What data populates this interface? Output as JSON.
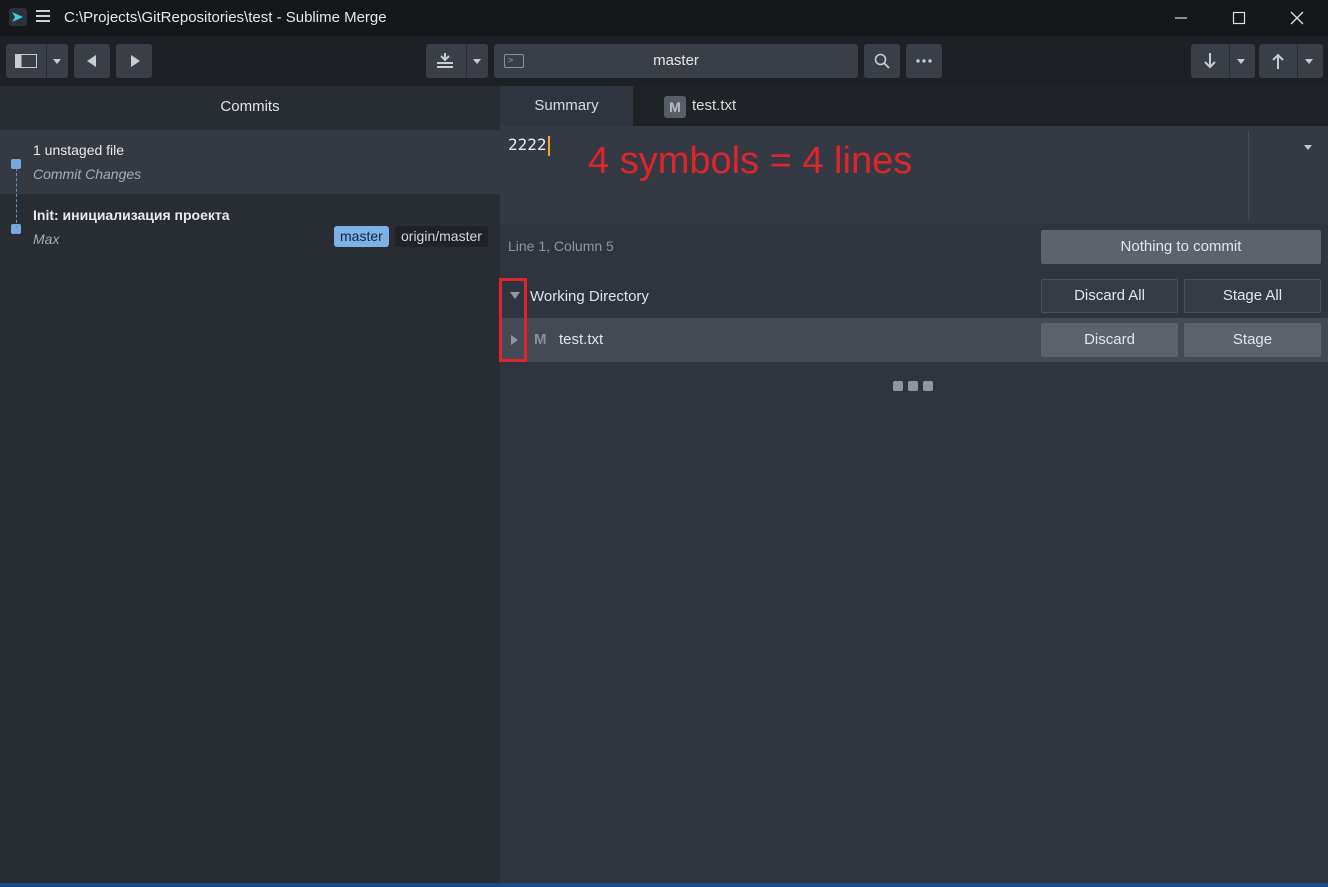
{
  "window": {
    "title": "C:\\Projects\\GitRepositories\\test - Sublime Merge"
  },
  "toolbar": {
    "branch": "master"
  },
  "left_panel": {
    "header": "Commits",
    "commits": [
      {
        "title": "1 unstaged file",
        "subtitle": "Commit Changes"
      },
      {
        "title": "Init: инициализация проекта",
        "subtitle": "Max",
        "badges": [
          "master",
          "origin/master"
        ]
      }
    ]
  },
  "right_panel": {
    "tabs": [
      {
        "label": "Summary"
      },
      {
        "label": "test.txt",
        "badge": "M"
      }
    ],
    "editor": {
      "text": "2222",
      "annotation": "4 symbols = 4 lines"
    },
    "status": "Line 1, Column 5",
    "commit_button": "Nothing to commit",
    "working_directory": {
      "label": "Working Directory",
      "discard_all": "Discard All",
      "stage_all": "Stage All"
    },
    "file": {
      "status": "M",
      "name": "test.txt",
      "discard": "Discard",
      "stage": "Stage"
    }
  },
  "colors": {
    "accent": "#7aa7df",
    "annotation": "#e0242b",
    "caret": "#f0a531"
  }
}
